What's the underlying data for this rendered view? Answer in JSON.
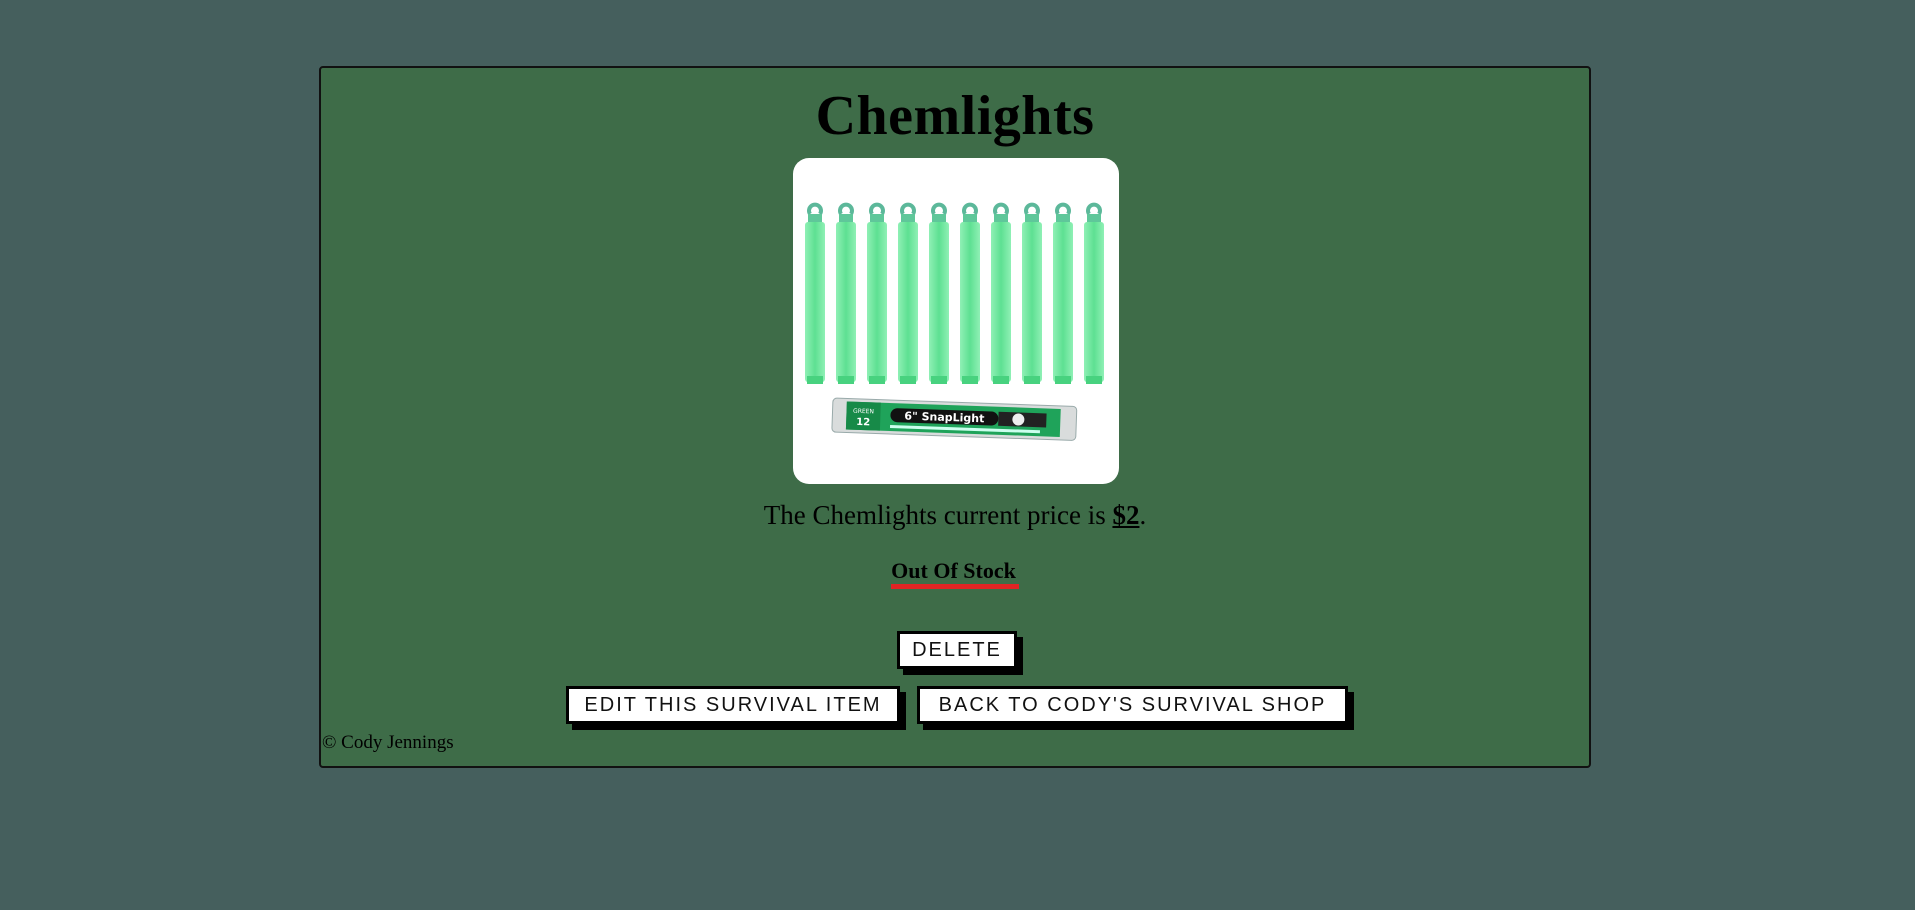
{
  "product": {
    "title": "Chemlights",
    "image_alt": "Green 6\" SnapLight chemlight sticks, 12 pack",
    "price_prefix": "The Chemlights current price is ",
    "price_value": "$2",
    "price_suffix": ".",
    "stock_status": "Out Of Stock",
    "stock_status_color": "#e02424"
  },
  "actions": {
    "delete_label": "DELETE",
    "edit_label": "EDIT THIS SURVIVAL ITEM",
    "back_label": "BACK TO CODY'S SURVIVAL SHOP"
  },
  "footer": {
    "copyright": "© Cody Jennings"
  },
  "colors": {
    "page_background": "#455f5d",
    "card_background": "#3e6c48",
    "stick_green": "#63e095"
  }
}
